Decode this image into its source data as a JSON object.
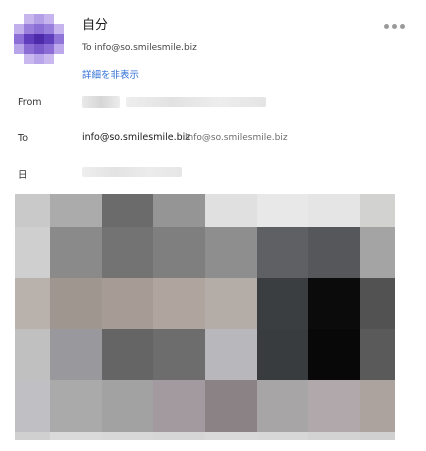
{
  "message": {
    "sender_name": "自分",
    "to_line": "To info@so.smilesmile.biz",
    "toggle_details": "詳細を非表示"
  },
  "details": {
    "from_label": "From",
    "to_label": "To",
    "date_label": "日",
    "to_primary": "info@so.smilesmile.biz",
    "to_secondary": "info@so.smilesmile.biz"
  },
  "icons": {
    "more": "more-horizontal-icon",
    "avatar": "avatar"
  },
  "colors": {
    "link": "#2f6fd6",
    "avatar_purple": "#6a3fc2",
    "dots": "#9a9a9a"
  }
}
